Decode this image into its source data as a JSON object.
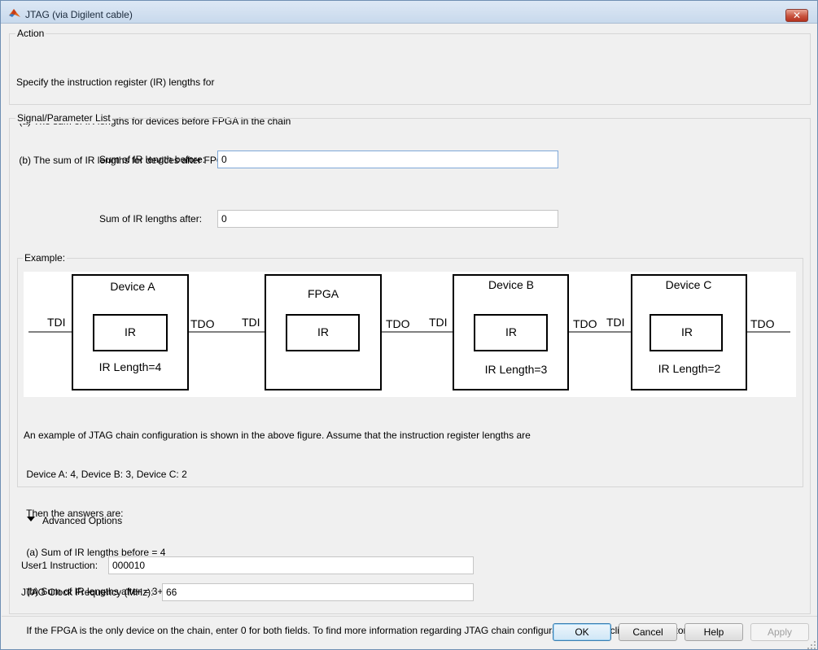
{
  "window": {
    "title": "JTAG (via Digilent cable)",
    "close_glyph": "✕"
  },
  "action": {
    "legend": "Action",
    "lines": [
      "Specify the instruction register (IR) lengths for",
      " (a) The sum of IR lengths for devices before FPGA in the chain",
      " (b) The sum of IR lengths for devices after FPGA in the chain"
    ]
  },
  "params": {
    "legend": "Signal/Parameter List",
    "before_label": "Sum of IR length before:",
    "before_value": "0",
    "after_label": "Sum of IR lengths after:",
    "after_value": "0"
  },
  "example": {
    "legend": "Example:",
    "devices": [
      {
        "name": "Device A",
        "ir": "IR",
        "ir_length": "IR Length=4",
        "tdi": "TDI",
        "tdo": "TDO"
      },
      {
        "name": "FPGA",
        "ir": "IR",
        "ir_length": "",
        "tdi": "TDI",
        "tdo": "TDO"
      },
      {
        "name": "Device B",
        "ir": "IR",
        "ir_length": "IR Length=3",
        "tdi": "TDI",
        "tdo": "TDO"
      },
      {
        "name": "Device C",
        "ir": "IR",
        "ir_length": "IR Length=2",
        "tdi": "TDI",
        "tdo": "TDO"
      }
    ],
    "text_lines": [
      "An example of JTAG chain configuration is shown in the above figure. Assume that the instruction register lengths are",
      " Device A: 4, Device B: 3, Device C: 2",
      " Then the answers are:",
      " (a) Sum of IR lengths before = 4",
      " (b) Sum of IR lengths after = 3+2 = 5",
      " If the FPGA is the only device on the chain, enter 0 for both fields. To find more information regarding JTAG chain configuration, please click \"Help\" button."
    ]
  },
  "advanced": {
    "label": "Advanced Options",
    "user1_label": "User1 Instruction:",
    "user1_value": "000010",
    "clock_label": "JTAG Clock Frequency (MHz):",
    "clock_value": "66"
  },
  "buttons": {
    "ok": "OK",
    "cancel": "Cancel",
    "help": "Help",
    "apply": "Apply"
  },
  "colors": {
    "accent": "#3c7fb1",
    "close": "#c8543f"
  }
}
